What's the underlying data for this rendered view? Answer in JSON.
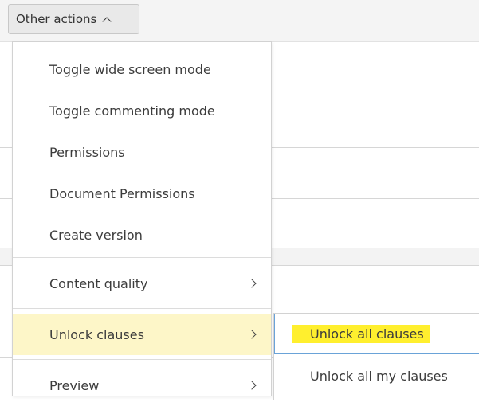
{
  "toolbar": {
    "other_actions_label": "Other actions"
  },
  "menu": {
    "items": [
      {
        "label": "Toggle wide screen mode"
      },
      {
        "label": "Toggle commenting mode"
      },
      {
        "label": "Permissions"
      },
      {
        "label": "Document Permissions"
      },
      {
        "label": "Create version"
      },
      {
        "label": "Content quality"
      },
      {
        "label": "Unlock clauses"
      },
      {
        "label": "Preview"
      }
    ]
  },
  "submenu": {
    "items": [
      {
        "label": "Unlock all clauses"
      },
      {
        "label": "Unlock all my clauses"
      }
    ]
  },
  "colors": {
    "highlight_bg": "#fdf6c8",
    "text_highlight": "#ffef2e",
    "active_outline": "#6aa3d8"
  },
  "icons": [
    "chevron-up-icon",
    "chevron-right-icon"
  ]
}
